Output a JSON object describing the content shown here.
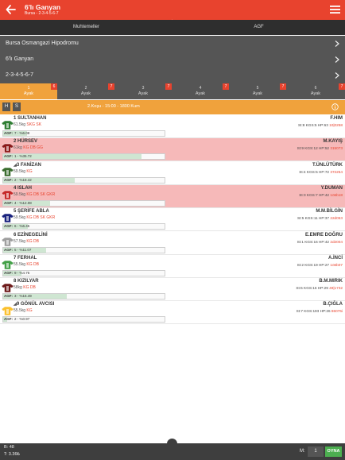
{
  "header": {
    "title": "6'lı Ganyan",
    "subtitle": "Bursa - 2-3-4-5-6-7"
  },
  "tabs": [
    {
      "label": "Muhtemeller"
    },
    {
      "label": "AGF"
    }
  ],
  "selectors": [
    {
      "label": "Bursa Osmangazi Hipodromu"
    },
    {
      "label": "6'lı Ganyan"
    },
    {
      "label": "2-3-4-5-6-7"
    }
  ],
  "legs": [
    {
      "num": "1",
      "label": "Ayak",
      "badge": "6",
      "active": true
    },
    {
      "num": "2",
      "label": "Ayak",
      "badge": "7",
      "active": false
    },
    {
      "num": "3",
      "label": "Ayak",
      "badge": "7",
      "active": false
    },
    {
      "num": "4",
      "label": "Ayak",
      "badge": "7",
      "active": false
    },
    {
      "num": "5",
      "label": "Ayak",
      "badge": "7",
      "active": false
    },
    {
      "num": "6",
      "label": "Ayak",
      "badge": "7",
      "active": false
    }
  ],
  "race_bar": {
    "h_label": "H",
    "s_label": "S",
    "info": "2.Koşu - 15:00 - 1800 Kum"
  },
  "horses": [
    {
      "name": "1 SULTANHAN",
      "eq": "",
      "weight": "61.5kg",
      "tags": "SKG SK",
      "agf_tag": "AGF:",
      "agf": "7 - %6.08",
      "agf_pct": 6.08,
      "jockey": "F.HIM",
      "stats": "St:8 KGS:5 HP:63",
      "tail": "10|0258",
      "scratched": false,
      "jersey_color": "#2e7d32"
    },
    {
      "name": "2 HÜRSEV",
      "eq": "",
      "weight": "61kg",
      "tags": "KG DB GG",
      "agf_tag": "AGF:",
      "agf": "1 - %35.72",
      "agf_pct": 35.72,
      "jockey": "M.KAYIŞ",
      "stats": "St:9 KGS:12 HP:52",
      "tail": "315073",
      "scratched": true,
      "jersey_color": "#8b1a1a"
    },
    {
      "name": "3 FANİZAN",
      "eq": "◢",
      "weight": "59.5kg",
      "tags": "KG",
      "agf_tag": "AGF:",
      "agf": "2 - %18.42",
      "agf_pct": 18.42,
      "jockey": "T.ÜNLÜTÜRK",
      "stats": "St:4 KGS:5 HP:72",
      "tail": "372254",
      "scratched": false,
      "jersey_color": "#3a6d2f"
    },
    {
      "name": "4 ISLAH",
      "eq": "",
      "weight": "59.5kg",
      "tags": "KG DB SK GKR",
      "agf_tag": "AGF:",
      "agf": "4 - %12.08",
      "agf_pct": 12.08,
      "jockey": "Y.DUMAN",
      "stats": "St:3 KGS:7 HP:42",
      "tail": "1ö6b18",
      "scratched": true,
      "jersey_color": "#c62828"
    },
    {
      "name": "5 ŞERİFE ABLA",
      "eq": "",
      "weight": "59.5kg",
      "tags": "KG DB SK GKR",
      "agf_tag": "AGF:",
      "agf": "6 - %6.45",
      "agf_pct": 6.45,
      "jockey": "M.M.BİLGİN",
      "stats": "St:5 KGS:11 HP:37",
      "tail": "22d053",
      "scratched": false,
      "jersey_color": "#1a237e"
    },
    {
      "name": "6 EZİNEGELİNİ",
      "eq": "",
      "weight": "57.5kg",
      "tags": "KG DB",
      "agf_tag": "AGF:",
      "agf": "5 - %11.07",
      "agf_pct": 11.07,
      "jockey": "E.EMRE DOĞRU",
      "stats": "St:1 KGS:16 HP:42",
      "tail": "2d2004",
      "scratched": false,
      "jersey_color": "#9e9e9e"
    },
    {
      "name": "7 FERHAL",
      "eq": "",
      "weight": "55.5kg",
      "tags": "KG DB",
      "agf_tag": "AGF:",
      "agf": "9 - %4.75",
      "agf_pct": 4.75,
      "jockey": "A.İNCİ",
      "stats": "St:2 KGS:19 HP:27",
      "tail": "1ö6b07",
      "scratched": false,
      "jersey_color": "#43a047"
    },
    {
      "name": "8 KIZILYAR",
      "eq": "",
      "weight": "58kg",
      "tags": "KG DB",
      "agf_tag": "AGF:",
      "agf": "3 - %16.49",
      "agf_pct": 16.49,
      "jockey": "B.M.MIRIK",
      "stats": "St:6 KGS:16 HP:29",
      "tail": "49|1732",
      "scratched": false,
      "jersey_color": "#6d1b1b"
    },
    {
      "name": "9 GÖNÜL AVCISI",
      "eq": "◢",
      "weight": "55.5kg",
      "tags": "KG",
      "agf_tag": "AGF:",
      "agf": "2 - %0.97",
      "agf_pct": 0.97,
      "jockey": "B.ÇIĞLA",
      "stats": "St:7 KGS:193 HP:26",
      "tail": "86076i",
      "scratched": false,
      "jersey_color": "#fbc02d"
    }
  ],
  "footer": {
    "bet_count": "B: 48",
    "total": "T: 3.36₺",
    "multiplier_label": "M:",
    "multiplier": "1",
    "play_label": "OYNA"
  }
}
